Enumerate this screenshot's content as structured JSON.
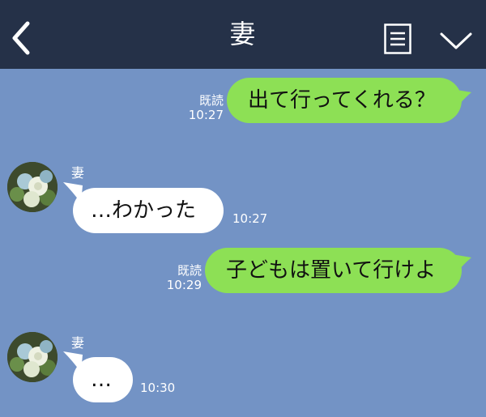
{
  "header": {
    "title": "妻",
    "back_icon": "chevron-left-icon",
    "menu_icon": "list-icon",
    "dropdown_icon": "chevron-down-icon"
  },
  "colors": {
    "header_bg": "#253148",
    "chat_bg": "#7393c5",
    "outgoing_bubble": "#8de055",
    "incoming_bubble": "#ffffff"
  },
  "messages": [
    {
      "direction": "out",
      "text": "出て行ってくれる？",
      "read_label": "既読",
      "time": "10:27"
    },
    {
      "direction": "in",
      "sender": "妻",
      "text": "…わかった",
      "time": "10:27"
    },
    {
      "direction": "out",
      "text": "子どもは置いて行けよ",
      "read_label": "既読",
      "time": "10:29"
    },
    {
      "direction": "in",
      "sender": "妻",
      "text": "…",
      "time": "10:30"
    }
  ]
}
